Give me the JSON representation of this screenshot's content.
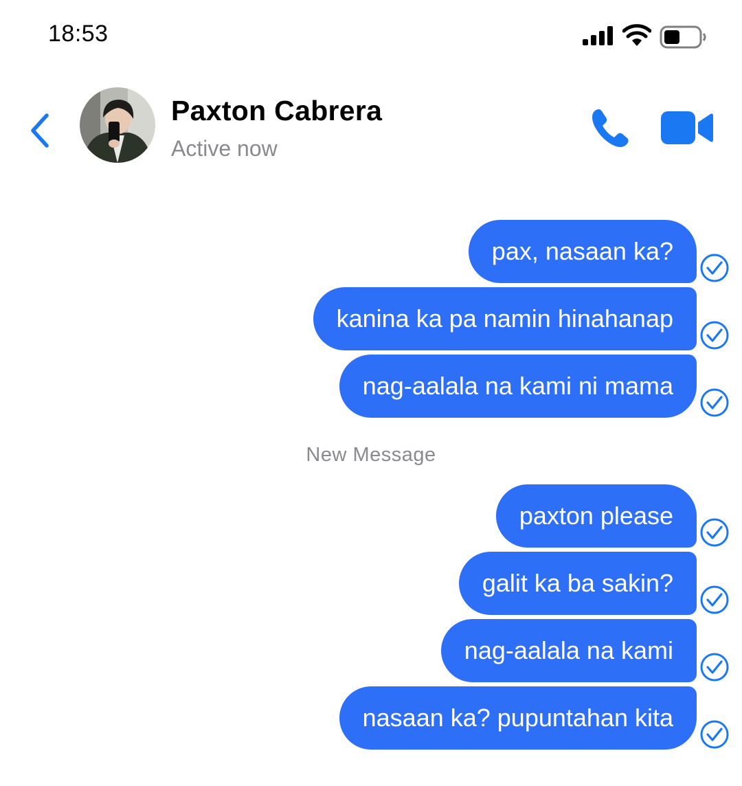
{
  "status_bar": {
    "time": "18:53"
  },
  "header": {
    "contact_name": "Paxton Cabrera",
    "contact_status": "Active now",
    "accent_color": "#1a78f2"
  },
  "messages_group_1": [
    {
      "text": "pax, nasaan ka?"
    },
    {
      "text": "kanina ka pa namin hinahanap"
    },
    {
      "text": "nag-aalala na kami ni mama"
    }
  ],
  "divider": {
    "label": "New Message"
  },
  "messages_group_2": [
    {
      "text": "paxton please"
    },
    {
      "text": "galit ka ba sakin?"
    },
    {
      "text": "nag-aalala na kami"
    },
    {
      "text": "nasaan ka? pupuntahan kita"
    }
  ],
  "colors": {
    "bubble": "#2d6ff7",
    "secondary_text": "#8a8a8e"
  }
}
